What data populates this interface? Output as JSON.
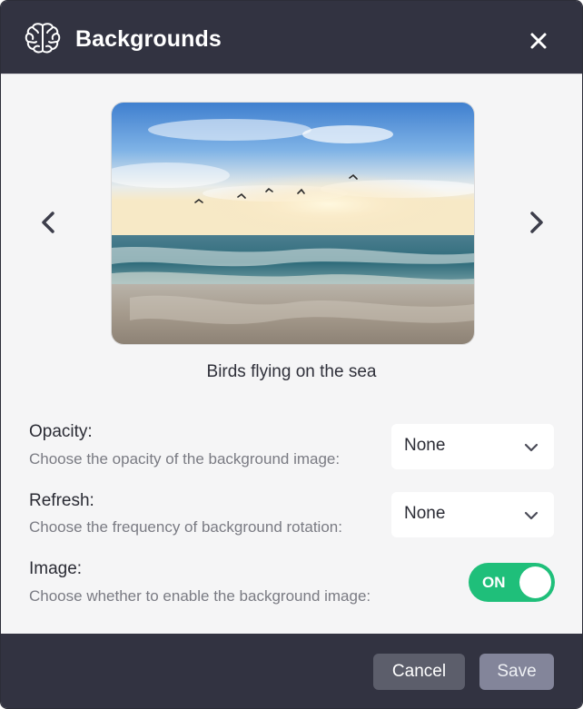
{
  "dialog": {
    "title": "Backgrounds",
    "icon": "brain-icon",
    "close_icon": "close-icon"
  },
  "carousel": {
    "prev_icon": "chevron-left-icon",
    "next_icon": "chevron-right-icon",
    "image_caption": "Birds flying on the sea"
  },
  "settings": {
    "opacity": {
      "title": "Opacity:",
      "description": "Choose the opacity of the background image:",
      "selected": "None"
    },
    "refresh": {
      "title": "Refresh:",
      "description": "Choose the frequency of background rotation:",
      "selected": "None"
    },
    "image": {
      "title": "Image:",
      "description": "Choose whether to enable the background image:",
      "toggle_label": "ON",
      "enabled": true
    }
  },
  "footer": {
    "cancel_label": "Cancel",
    "save_label": "Save"
  },
  "colors": {
    "header_bg": "#323341",
    "toggle_on": "#1fbf7a",
    "cancel_bg": "#5c5e6b",
    "save_bg": "#83859a"
  }
}
